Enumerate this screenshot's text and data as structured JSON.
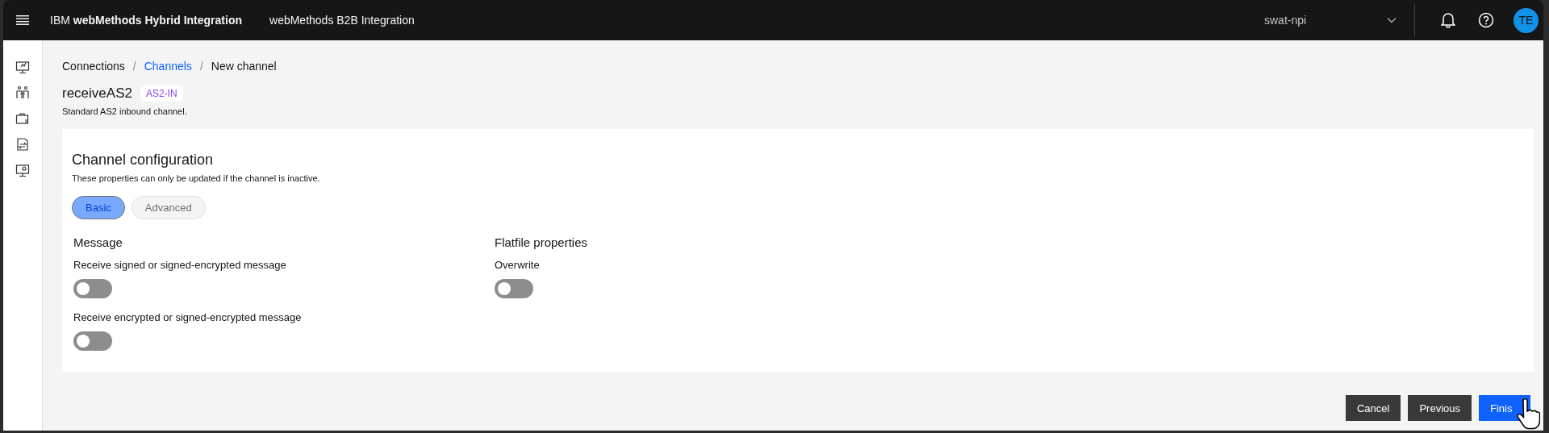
{
  "header": {
    "product": "IBM **webMethods Hybrid Integration**",
    "app": "webMethods B2B Integration",
    "tenant": "swat-npi",
    "avatar": "TE"
  },
  "sidebar": {
    "items": [
      {
        "kind": "monitor"
      },
      {
        "kind": "partners"
      },
      {
        "kind": "briefcase"
      },
      {
        "kind": "exchange"
      },
      {
        "kind": "settings"
      }
    ]
  },
  "breadcrumb": [
    {
      "label": "Connections",
      "link": false
    },
    {
      "separator": "/",
      "label": "Channels",
      "link": true
    },
    {
      "separator": "/",
      "label": "New channel",
      "link": false
    }
  ],
  "page": {
    "title": "receiveAS2",
    "tag": "AS2-IN",
    "description": "Standard AS2 inbound channel."
  },
  "card": {
    "title": "Channel configuration",
    "subtitle": "These properties can only be updated if the channel is inactive.",
    "tabs": [
      {
        "label": "Basic",
        "selected": true
      },
      {
        "label": "Advanced",
        "selected": false
      }
    ],
    "sections": [
      {
        "title": "Message",
        "toggles": [
          {
            "label": "Receive signed or signed-encrypted message",
            "on": false
          },
          {
            "label": "Receive encrypted or signed-encrypted message",
            "on": false
          }
        ]
      },
      {
        "title": "Flatfile properties",
        "toggles": [
          {
            "label": "Overwrite",
            "on": false
          }
        ]
      }
    ]
  },
  "buttons": [
    {
      "label": "Cancel",
      "kind": "secondary"
    },
    {
      "label": "Previous",
      "kind": "secondary"
    },
    {
      "label": "Finis",
      "kind": "primary"
    }
  ]
}
